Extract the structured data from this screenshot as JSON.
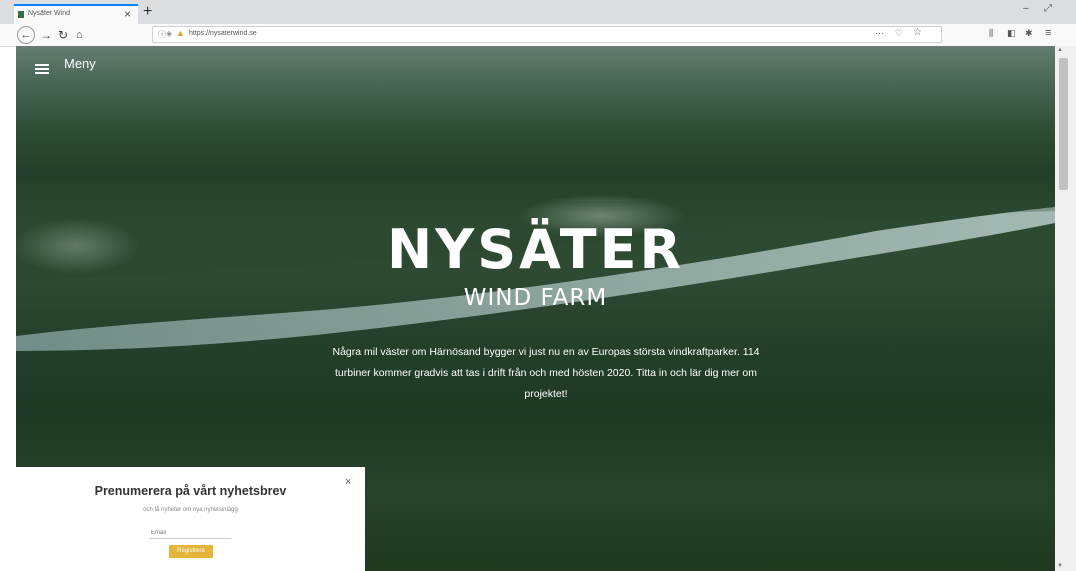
{
  "browser": {
    "tab_title": "Nysäter Wind",
    "tab_close": "×",
    "new_tab": "+",
    "url": "https://nysaterwind.se",
    "window_controls": [
      "–",
      "⤢"
    ],
    "icons": [
      "back-arrow-icon",
      "forward-arrow-icon",
      "reload-icon",
      "home-icon",
      "info-icon",
      "lock-icon",
      "more-icon",
      "pocket-icon",
      "star-icon",
      "library-icon",
      "sidebar-icon",
      "extension-icon",
      "hamburger-menu-icon"
    ]
  },
  "page": {
    "menu_label": "Meny",
    "logo_main": "NYSÄTER",
    "logo_sub": "WIND FARM",
    "intro": "Några mil väster om Härnösand bygger vi just nu en av Europas största vindkraftparker. 114 turbiner kommer gradvis att tas i drift från och med hösten 2020. Titta in och lär dig mer om projektet!"
  },
  "popup": {
    "title": "Prenumerera på vårt nyhetsbrev",
    "subtitle": "och få nyheter om nya nyhetsinlägg",
    "email_placeholder": "Email",
    "button_label": "Registrera",
    "close": "×"
  },
  "colors": {
    "accent_button": "#e4b53a",
    "tab_highlight": "#0a84ff"
  }
}
